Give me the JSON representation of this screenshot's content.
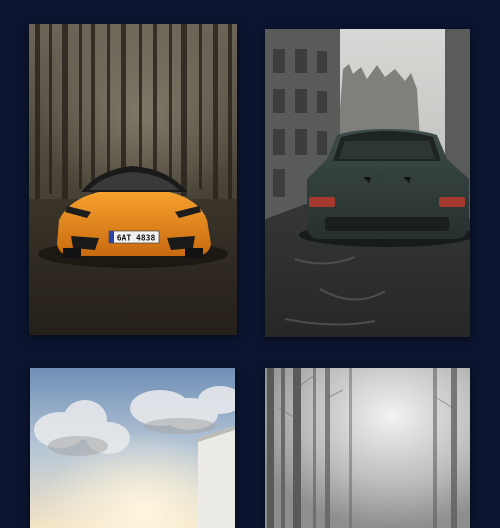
{
  "gallery": {
    "background_color": "#0c1530",
    "photos": [
      {
        "subject": "orange-sports-car-in-forest",
        "plate": "6AT 4838"
      },
      {
        "subject": "dark-green-sports-car-on-street"
      },
      {
        "subject": "sky-with-clouds-and-building"
      },
      {
        "subject": "misty-forest"
      }
    ]
  }
}
